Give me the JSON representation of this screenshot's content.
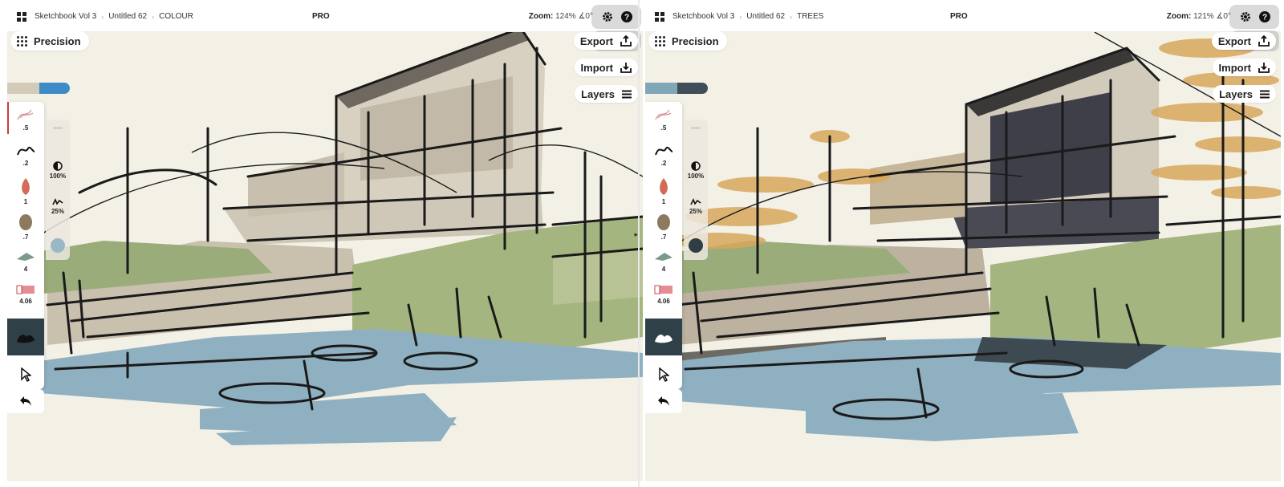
{
  "left": {
    "topbar": {
      "breadcrumbs": [
        "Sketchbook Vol 3",
        "Untitled 62",
        "COLOUR"
      ],
      "badge": "PRO",
      "zoom_label": "Zoom:",
      "zoom_value": "124%",
      "rotation": "∡0°"
    },
    "precision_label": "Precision",
    "buttons": {
      "export": "Export",
      "import": "Import",
      "layers": "Layers"
    },
    "tool_sizes": [
      ".5",
      ".2",
      "1",
      ".7",
      "4",
      "4.06"
    ],
    "subpanel": {
      "opacity": "100%",
      "flow": "25%"
    },
    "colors": {
      "swatch_a": "#d3cbb7",
      "swatch_b": "#3d8cc7",
      "current": "#9ab7c6"
    }
  },
  "right": {
    "topbar": {
      "breadcrumbs": [
        "Sketchbook Vol 3",
        "Untitled 62",
        "TREES"
      ],
      "badge": "PRO",
      "zoom_label": "Zoom:",
      "zoom_value": "121%",
      "rotation": "∡0°"
    },
    "precision_label": "Precision",
    "buttons": {
      "export": "Export",
      "import": "Import",
      "layers": "Layers"
    },
    "tool_sizes": [
      ".5",
      ".2",
      "1",
      ".7",
      "4",
      "4.06"
    ],
    "subpanel": {
      "opacity": "100%",
      "flow": "25%"
    },
    "colors": {
      "swatch_a": "#7fa7b8",
      "swatch_b": "#3f4e58",
      "current": "#2f3d45"
    }
  },
  "icons": [
    "grid-icon",
    "chevron-right-icon",
    "gear-icon",
    "help-icon",
    "dots-grid-icon",
    "export-icon",
    "import-icon",
    "layers-icon",
    "pencil-icon",
    "pen-icon",
    "round-brush-icon",
    "blob-brush-icon",
    "flat-brush-icon",
    "eraser-icon",
    "active-brush-icon",
    "select-arrow-icon",
    "undo-icon",
    "opacity-icon",
    "flow-icon"
  ]
}
